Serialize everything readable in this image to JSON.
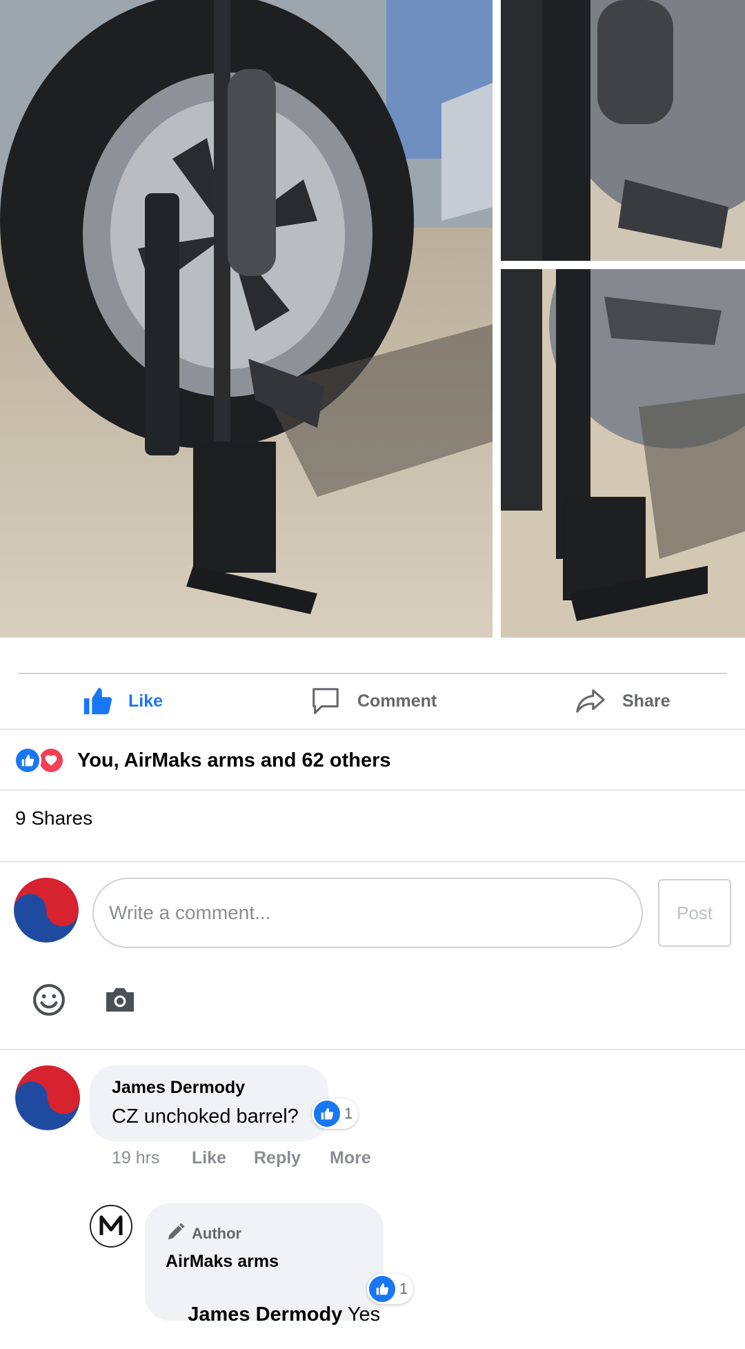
{
  "photos": [
    {
      "name": "photo-main",
      "alt": "rifle-against-wheel"
    },
    {
      "name": "photo-top-right",
      "alt": "rifle-detail"
    },
    {
      "name": "photo-bottom-right",
      "alt": "rifle-stock-detail"
    }
  ],
  "actions": {
    "like": "Like",
    "comment": "Comment",
    "share": "Share"
  },
  "reactions": {
    "summary": "You, AirMaks arms and 62 others"
  },
  "shares": "9 Shares",
  "composer": {
    "placeholder": "Write a comment...",
    "post": "Post"
  },
  "comments": [
    {
      "author": "James Dermody",
      "text": "CZ unchoked barrel?",
      "likes": "1",
      "time": "19 hrs",
      "like": "Like",
      "reply": "Reply",
      "more": "More"
    }
  ],
  "reply": {
    "badge": "Author",
    "author": "AirMaks arms",
    "mention": "James Dermody",
    "text": " Yes",
    "likes": "1"
  },
  "colors": {
    "accent": "#1877f2",
    "love": "#f33e58",
    "bubble": "#f0f2f5"
  }
}
